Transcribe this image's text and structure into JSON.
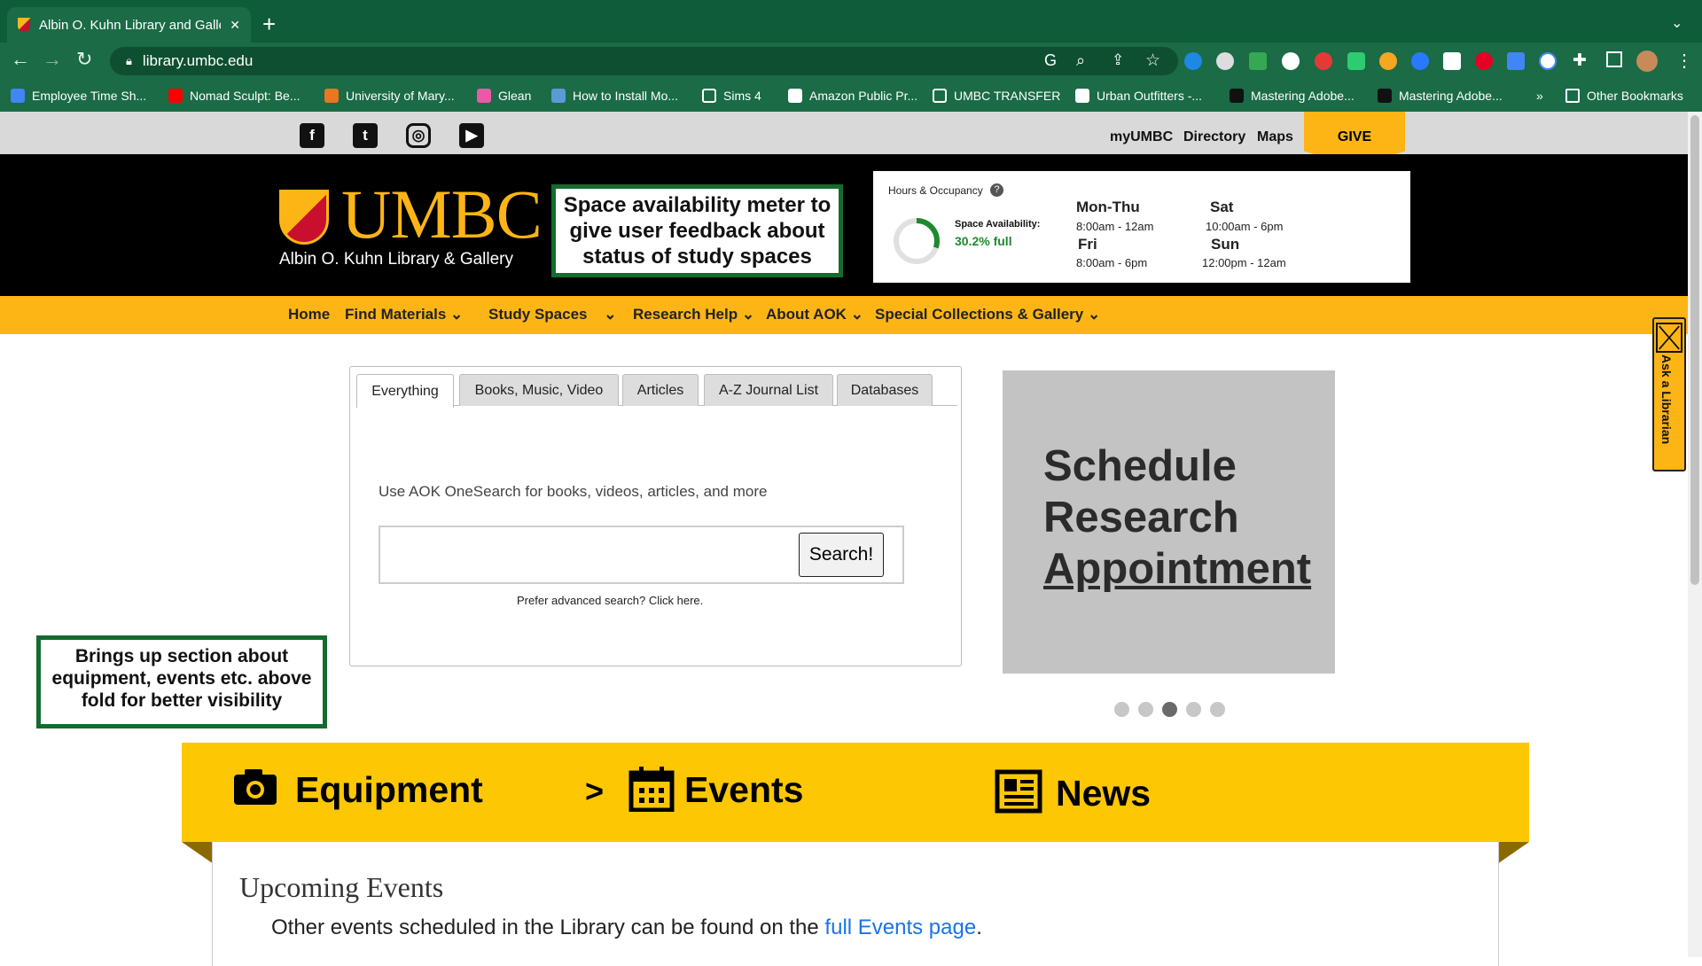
{
  "browser": {
    "tab_title": "Albin O. Kuhn Library and Galle",
    "tab_close": "✕",
    "new_tab": "+",
    "url": "library.umbc.edu",
    "bookmarks": [
      {
        "label": "Employee Time Sh...",
        "color": "#4285f4"
      },
      {
        "label": "Nomad Sculpt: Be...",
        "color": "#ff0000"
      },
      {
        "label": "University of Mary...",
        "color": "#e87722"
      },
      {
        "label": "Glean",
        "color": "#e85aa6"
      },
      {
        "label": "How to Install Mo...",
        "color": "#5b9bd5"
      },
      {
        "label": "Sims 4",
        "color": "folder"
      },
      {
        "label": "Amazon Public Pr...",
        "color": "#ffffff"
      },
      {
        "label": "UMBC TRANSFER",
        "color": "folder"
      },
      {
        "label": "Urban Outfitters -...",
        "color": "#ffffff"
      },
      {
        "label": "Mastering Adobe...",
        "color": "#111111"
      },
      {
        "label": "Mastering Adobe...",
        "color": "#111111"
      }
    ],
    "more_bookmarks": "»",
    "other_bookmarks": "Other Bookmarks"
  },
  "topbar": {
    "social": [
      "f",
      "t",
      "◎",
      "▶"
    ],
    "links": [
      "myUMBC",
      "Directory",
      "Maps"
    ],
    "give": "GIVE"
  },
  "header": {
    "logo_text": "UMBC",
    "logo_subtitle": "Albin O. Kuhn Library & Gallery",
    "annotation": "Space availability meter to give user feedback about status of study spaces"
  },
  "hours": {
    "title": "Hours & Occupancy",
    "help": "?",
    "space_label": "Space Availability:",
    "space_value": "30.2% full",
    "occupancy_fraction": 0.302,
    "days": [
      {
        "name": "Mon-Thu",
        "hours": "8:00am - 12am"
      },
      {
        "name": "Fri",
        "hours": "8:00am - 6pm"
      },
      {
        "name": "Sat",
        "hours": "10:00am - 6pm"
      },
      {
        "name": "Sun",
        "hours": "12:00pm - 12am"
      }
    ]
  },
  "nav": {
    "items": [
      "Home",
      "Find Materials",
      "Study Spaces",
      "Research Help",
      "About AOK",
      "Special Collections & Gallery"
    ]
  },
  "search": {
    "tabs": [
      "Everything",
      "Books, Music, Video",
      "Articles",
      "A-Z Journal List",
      "Databases"
    ],
    "hint": "Use AOK OneSearch for books, videos, articles, and more",
    "input_value": "",
    "button": "Search!",
    "advanced": "Prefer advanced search? Click here."
  },
  "carousel": {
    "line1": "Schedule",
    "line2": "Research",
    "line3": "Appointment",
    "slide_count": 5,
    "active_index": 2
  },
  "ask": {
    "label": "Ask a Librarian"
  },
  "annotation2": "Brings up section about equipment, events etc. above fold for better visibility",
  "band": {
    "equipment": "Equipment",
    "arrow": ">",
    "events": "Events",
    "news": "News"
  },
  "events": {
    "heading": "Upcoming Events",
    "text_before": "Other events scheduled in the Library can be found on the ",
    "link": "full Events page",
    "text_after": "."
  }
}
